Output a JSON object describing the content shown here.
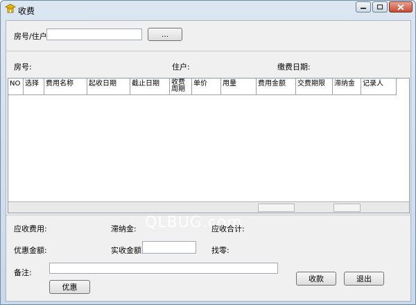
{
  "window": {
    "title": "收费",
    "controls": {
      "minimize": "–",
      "maximize": "□",
      "close": "✕"
    }
  },
  "search": {
    "label": "房号/住户",
    "value": "",
    "button_label": "..."
  },
  "info": {
    "room_label": "房号:",
    "resident_label": "住户:",
    "date_label": "缴费日期:"
  },
  "table": {
    "headers": [
      "NO",
      "选择",
      "费用名称",
      "起收日期",
      "截止日期",
      "收费周期",
      "单价",
      "用量",
      "费用金额",
      "交费期限",
      "滞纳金",
      "记录人"
    ],
    "rows": []
  },
  "summary": {
    "receivable_label": "应收费用:",
    "late_fee_label": "滞纳金:",
    "total_label": "应收合计:",
    "discount_label": "优惠金额:",
    "paid_label": "实收金额:",
    "paid_value": "",
    "change_label": "找零:",
    "note_label": "备注:",
    "note_value": ""
  },
  "buttons": {
    "discount": "优惠",
    "collect": "收款",
    "exit": "退出"
  },
  "watermark": "QLBUG.com"
}
